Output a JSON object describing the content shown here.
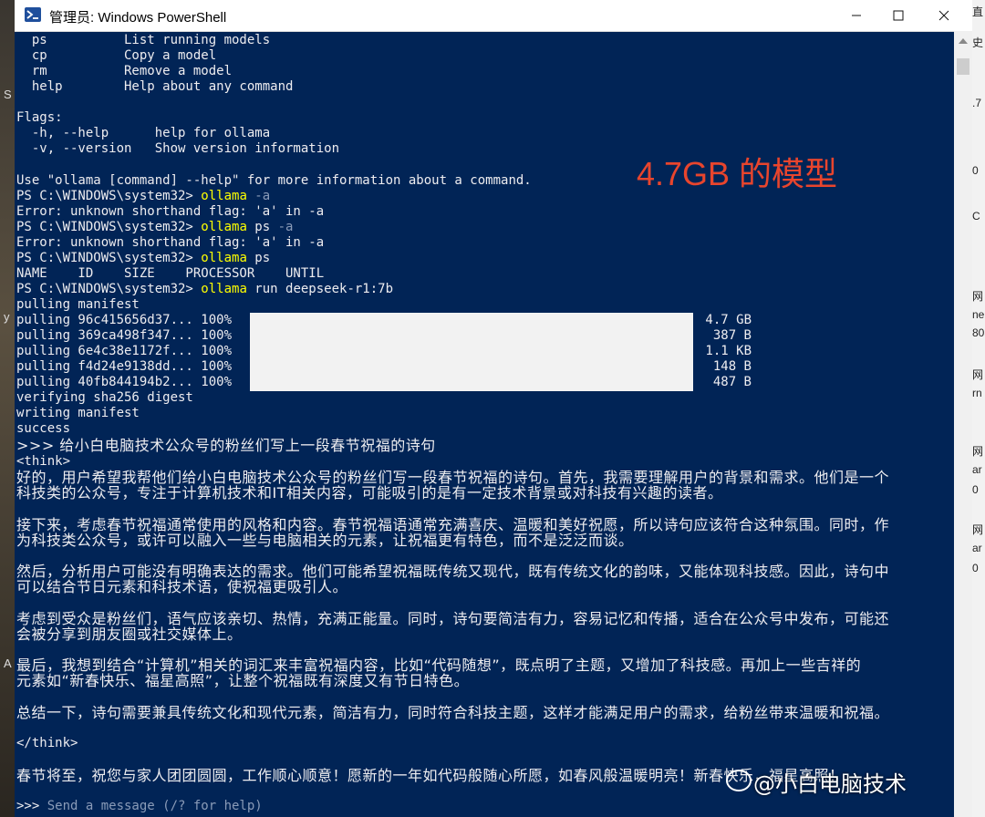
{
  "window": {
    "title": "管理员: Windows PowerShell"
  },
  "annotation": "4.7GB 的模型",
  "watermark": "@小白电脑技术",
  "side_fragments": [
    "直",
    "史",
    ".7",
    "0",
    "C",
    "网",
    "ne",
    "80",
    "网",
    "rn",
    "网",
    "ar",
    "0",
    "网",
    "ar",
    "0"
  ],
  "left_fragments": [
    "S",
    "y",
    "A"
  ],
  "console": {
    "l0": "  ps          List running models",
    "l1": "  cp          Copy a model",
    "l2": "  rm          Remove a model",
    "l3": "  help        Help about any command",
    "l4": "Flags:",
    "l5": "  -h, --help      help for ollama",
    "l6": "  -v, --version   Show version information",
    "l7": "Use \"ollama [command] --help\" for more information about a command.",
    "prompt": "PS C:\\WINDOWS\\system32> ",
    "cmd1": "ollama",
    "cmd1_arg": " -a",
    "err1": "Error: unknown shorthand flag: 'a' in -a",
    "cmd2": "ollama",
    "cmd2_arg": " ps",
    "cmd2_flag": " -a",
    "err2": "Error: unknown shorthand flag: 'a' in -a",
    "cmd3": "ollama",
    "cmd3_arg": " ps",
    "header": "NAME    ID    SIZE    PROCESSOR    UNTIL",
    "cmd4": "ollama",
    "cmd4_arg": " run deepseek-r1:7b",
    "pm": "pulling manifest",
    "p1": "pulling 96c415656d37... 100%",
    "p2": "pulling 369ca498f347... 100%",
    "p3": "pulling 6e4c38e1172f... 100%",
    "p4": "pulling f4d24e9138dd... 100%",
    "p5": "pulling 40fb844194b2... 100%",
    "s1": "4.7 GB",
    "s2": "387 B",
    "s3": "1.1 KB",
    "s4": "148 B",
    "s5": "487 B",
    "v1": "verifying sha256 digest",
    "v2": "writing manifest",
    "v3": "success",
    "q": ">>> 给小白电脑技术公众号的粉丝们写上一段春节祝福的诗句",
    "think_open": "<think>",
    "t1a": "好的，用户希望我帮他们给小白电脑技术公众号的粉丝们写一段春节祝福的诗句。首先，我需要理解用户的背景和需求。他们是一个",
    "t1b": "科技类的公众号，专注于计算机技术和IT相关内容，可能吸引的是有一定技术背景或对科技有兴趣的读者。",
    "t2a": "接下来，考虑春节祝福通常使用的风格和内容。春节祝福语通常充满喜庆、温暖和美好祝愿，所以诗句应该符合这种氛围。同时，作",
    "t2b": "为科技类公众号，或许可以融入一些与电脑相关的元素，让祝福更有特色，而不是泛泛而谈。",
    "t3a": "然后，分析用户可能没有明确表达的需求。他们可能希望祝福既传统又现代，既有传统文化的韵味，又能体现科技感。因此，诗句中",
    "t3b": "可以结合节日元素和科技术语，使祝福更吸引人。",
    "t4a": "考虑到受众是粉丝们，语气应该亲切、热情，充满正能量。同时，诗句要简洁有力，容易记忆和传播，适合在公众号中发布，可能还",
    "t4b": "会被分享到朋友圈或社交媒体上。",
    "t5a": "最后，我想到结合“计算机”相关的词汇来丰富祝福内容，比如“代码随想”，既点明了主题，又增加了科技感。再加上一些吉祥的",
    "t5b": "元素如“新春快乐、福星高照”，让整个祝福既有深度又有节日特色。",
    "t6": "总结一下，诗句需要兼具传统文化和现代元素，简洁有力，同时符合科技主题，这样才能满足用户的需求，给粉丝带来温暖和祝福。",
    "think_close": "</think>",
    "ans": "春节将至，祝您与家人团团圆圆，工作顺心顺意！愿新的一年如代码般随心所愿，如春风般温暖明亮！新春快乐，福星高照！",
    "input_prompt": ">>> ",
    "input_placeholder": "Send a message (/? for help)"
  }
}
